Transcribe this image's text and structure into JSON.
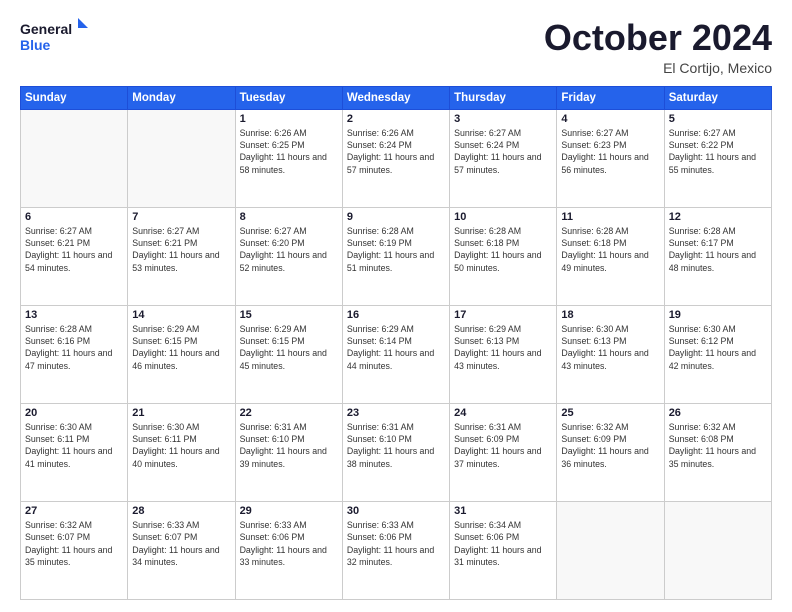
{
  "header": {
    "logo_general": "General",
    "logo_blue": "Blue",
    "month_title": "October 2024",
    "location": "El Cortijo, Mexico"
  },
  "weekdays": [
    "Sunday",
    "Monday",
    "Tuesday",
    "Wednesday",
    "Thursday",
    "Friday",
    "Saturday"
  ],
  "weeks": [
    [
      {
        "day": "",
        "sunrise": "",
        "sunset": "",
        "daylight": ""
      },
      {
        "day": "",
        "sunrise": "",
        "sunset": "",
        "daylight": ""
      },
      {
        "day": "1",
        "sunrise": "Sunrise: 6:26 AM",
        "sunset": "Sunset: 6:25 PM",
        "daylight": "Daylight: 11 hours and 58 minutes."
      },
      {
        "day": "2",
        "sunrise": "Sunrise: 6:26 AM",
        "sunset": "Sunset: 6:24 PM",
        "daylight": "Daylight: 11 hours and 57 minutes."
      },
      {
        "day": "3",
        "sunrise": "Sunrise: 6:27 AM",
        "sunset": "Sunset: 6:24 PM",
        "daylight": "Daylight: 11 hours and 57 minutes."
      },
      {
        "day": "4",
        "sunrise": "Sunrise: 6:27 AM",
        "sunset": "Sunset: 6:23 PM",
        "daylight": "Daylight: 11 hours and 56 minutes."
      },
      {
        "day": "5",
        "sunrise": "Sunrise: 6:27 AM",
        "sunset": "Sunset: 6:22 PM",
        "daylight": "Daylight: 11 hours and 55 minutes."
      }
    ],
    [
      {
        "day": "6",
        "sunrise": "Sunrise: 6:27 AM",
        "sunset": "Sunset: 6:21 PM",
        "daylight": "Daylight: 11 hours and 54 minutes."
      },
      {
        "day": "7",
        "sunrise": "Sunrise: 6:27 AM",
        "sunset": "Sunset: 6:21 PM",
        "daylight": "Daylight: 11 hours and 53 minutes."
      },
      {
        "day": "8",
        "sunrise": "Sunrise: 6:27 AM",
        "sunset": "Sunset: 6:20 PM",
        "daylight": "Daylight: 11 hours and 52 minutes."
      },
      {
        "day": "9",
        "sunrise": "Sunrise: 6:28 AM",
        "sunset": "Sunset: 6:19 PM",
        "daylight": "Daylight: 11 hours and 51 minutes."
      },
      {
        "day": "10",
        "sunrise": "Sunrise: 6:28 AM",
        "sunset": "Sunset: 6:18 PM",
        "daylight": "Daylight: 11 hours and 50 minutes."
      },
      {
        "day": "11",
        "sunrise": "Sunrise: 6:28 AM",
        "sunset": "Sunset: 6:18 PM",
        "daylight": "Daylight: 11 hours and 49 minutes."
      },
      {
        "day": "12",
        "sunrise": "Sunrise: 6:28 AM",
        "sunset": "Sunset: 6:17 PM",
        "daylight": "Daylight: 11 hours and 48 minutes."
      }
    ],
    [
      {
        "day": "13",
        "sunrise": "Sunrise: 6:28 AM",
        "sunset": "Sunset: 6:16 PM",
        "daylight": "Daylight: 11 hours and 47 minutes."
      },
      {
        "day": "14",
        "sunrise": "Sunrise: 6:29 AM",
        "sunset": "Sunset: 6:15 PM",
        "daylight": "Daylight: 11 hours and 46 minutes."
      },
      {
        "day": "15",
        "sunrise": "Sunrise: 6:29 AM",
        "sunset": "Sunset: 6:15 PM",
        "daylight": "Daylight: 11 hours and 45 minutes."
      },
      {
        "day": "16",
        "sunrise": "Sunrise: 6:29 AM",
        "sunset": "Sunset: 6:14 PM",
        "daylight": "Daylight: 11 hours and 44 minutes."
      },
      {
        "day": "17",
        "sunrise": "Sunrise: 6:29 AM",
        "sunset": "Sunset: 6:13 PM",
        "daylight": "Daylight: 11 hours and 43 minutes."
      },
      {
        "day": "18",
        "sunrise": "Sunrise: 6:30 AM",
        "sunset": "Sunset: 6:13 PM",
        "daylight": "Daylight: 11 hours and 43 minutes."
      },
      {
        "day": "19",
        "sunrise": "Sunrise: 6:30 AM",
        "sunset": "Sunset: 6:12 PM",
        "daylight": "Daylight: 11 hours and 42 minutes."
      }
    ],
    [
      {
        "day": "20",
        "sunrise": "Sunrise: 6:30 AM",
        "sunset": "Sunset: 6:11 PM",
        "daylight": "Daylight: 11 hours and 41 minutes."
      },
      {
        "day": "21",
        "sunrise": "Sunrise: 6:30 AM",
        "sunset": "Sunset: 6:11 PM",
        "daylight": "Daylight: 11 hours and 40 minutes."
      },
      {
        "day": "22",
        "sunrise": "Sunrise: 6:31 AM",
        "sunset": "Sunset: 6:10 PM",
        "daylight": "Daylight: 11 hours and 39 minutes."
      },
      {
        "day": "23",
        "sunrise": "Sunrise: 6:31 AM",
        "sunset": "Sunset: 6:10 PM",
        "daylight": "Daylight: 11 hours and 38 minutes."
      },
      {
        "day": "24",
        "sunrise": "Sunrise: 6:31 AM",
        "sunset": "Sunset: 6:09 PM",
        "daylight": "Daylight: 11 hours and 37 minutes."
      },
      {
        "day": "25",
        "sunrise": "Sunrise: 6:32 AM",
        "sunset": "Sunset: 6:09 PM",
        "daylight": "Daylight: 11 hours and 36 minutes."
      },
      {
        "day": "26",
        "sunrise": "Sunrise: 6:32 AM",
        "sunset": "Sunset: 6:08 PM",
        "daylight": "Daylight: 11 hours and 35 minutes."
      }
    ],
    [
      {
        "day": "27",
        "sunrise": "Sunrise: 6:32 AM",
        "sunset": "Sunset: 6:07 PM",
        "daylight": "Daylight: 11 hours and 35 minutes."
      },
      {
        "day": "28",
        "sunrise": "Sunrise: 6:33 AM",
        "sunset": "Sunset: 6:07 PM",
        "daylight": "Daylight: 11 hours and 34 minutes."
      },
      {
        "day": "29",
        "sunrise": "Sunrise: 6:33 AM",
        "sunset": "Sunset: 6:06 PM",
        "daylight": "Daylight: 11 hours and 33 minutes."
      },
      {
        "day": "30",
        "sunrise": "Sunrise: 6:33 AM",
        "sunset": "Sunset: 6:06 PM",
        "daylight": "Daylight: 11 hours and 32 minutes."
      },
      {
        "day": "31",
        "sunrise": "Sunrise: 6:34 AM",
        "sunset": "Sunset: 6:06 PM",
        "daylight": "Daylight: 11 hours and 31 minutes."
      },
      {
        "day": "",
        "sunrise": "",
        "sunset": "",
        "daylight": ""
      },
      {
        "day": "",
        "sunrise": "",
        "sunset": "",
        "daylight": ""
      }
    ]
  ]
}
